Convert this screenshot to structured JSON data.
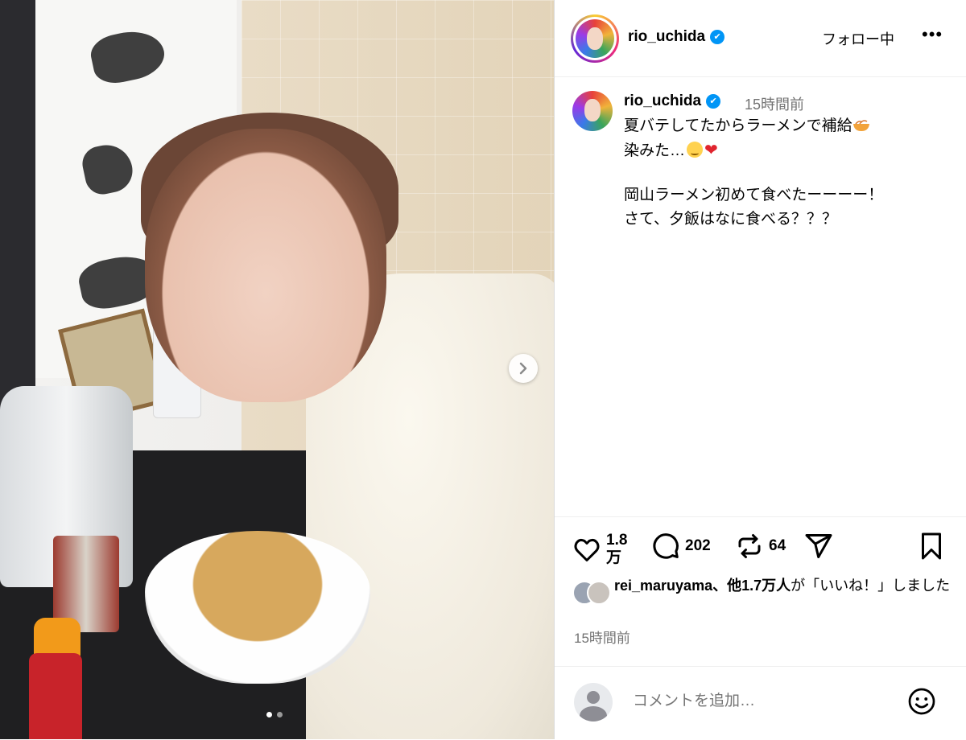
{
  "post": {
    "carousel": {
      "next_icon": "chevron-right-icon",
      "current_index": 1,
      "total": 2
    },
    "header": {
      "username": "rio_uchida",
      "follow_label": "フォロー中",
      "more_icon": "more-horizontal-icon"
    },
    "caption": {
      "username": "rio_uchida",
      "time": "15時間前",
      "lines": {
        "l1": "夏バテしてたからラーメンで補給",
        "l2": "染みた…",
        "l3": "岡山ラーメン初めて食べたーーーー！",
        "l4": "さて、夕飯はなに食べる？？？"
      }
    },
    "actions": {
      "likes": "1.8\n万",
      "comments": "202",
      "reposts": "64",
      "icons": [
        "heart-icon",
        "comment-icon",
        "repost-icon",
        "share-icon",
        "bookmark-icon"
      ]
    },
    "liked_by": {
      "user": "rei_maruyama",
      "rest_bold": "、他1.7万人",
      "suffix": "が「いいね！」しました"
    },
    "timestamp": "15時間前",
    "comment": {
      "placeholder": "コメントを追加…"
    },
    "colors": {
      "verified": "#0095f6",
      "muted_text": "#737373",
      "heart_emoji": "#e0242e"
    }
  }
}
